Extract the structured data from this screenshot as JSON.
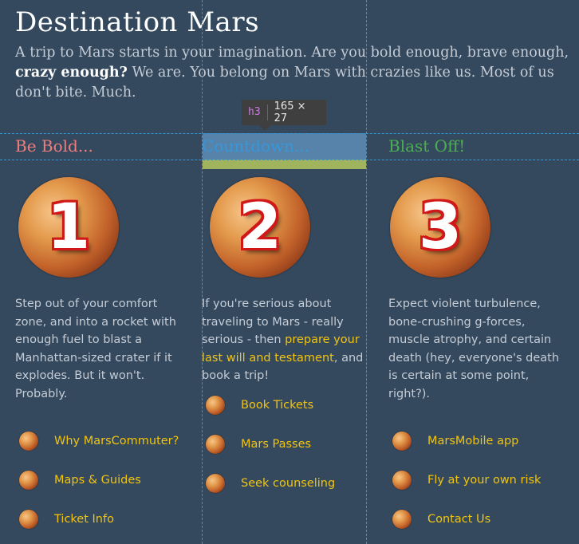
{
  "page": {
    "title": "Destination Mars",
    "intro_1": "A trip to Mars starts in your imagination. Are you bold enough, brave enough, ",
    "intro_bold": "crazy enough?",
    "intro_2": " We are. You belong on Mars with crazies like us. Most of us don't bite. Much."
  },
  "inspector": {
    "tag": "h3",
    "size": "165 × 27"
  },
  "columns": [
    {
      "heading": "Be Bold...",
      "heading_color": "#f07c7c",
      "number": "1",
      "desc_1": "Step out of your comfort zone, and into a rocket with enough fuel to blast a Manhattan-sized crater if it explodes. But it won't. Probably.",
      "links": [
        "Why MarsCommuter?",
        "Maps & Guides",
        "Ticket Info"
      ]
    },
    {
      "heading": "Countdown...",
      "heading_color": "#3498db",
      "number": "2",
      "desc_1": "If you're serious about traveling to Mars - really serious - then ",
      "desc_link": "prepare your last will and testament",
      "desc_2": ", and book a trip!",
      "links": [
        "Book Tickets",
        "Mars Passes",
        "Seek counseling"
      ]
    },
    {
      "heading": "Blast Off!",
      "heading_color": "#4caf50",
      "number": "3",
      "desc_1": "Expect violent turbulence, bone-crushing g-forces, muscle atrophy, and certain death (hey, everyone's death is certain at some point, right?).",
      "links": [
        "MarsMobile app",
        "Fly at your own risk",
        "Contact Us"
      ]
    }
  ],
  "colors": {
    "background": "#34495e",
    "link": "#f1c40f",
    "guides": "#3498db"
  }
}
